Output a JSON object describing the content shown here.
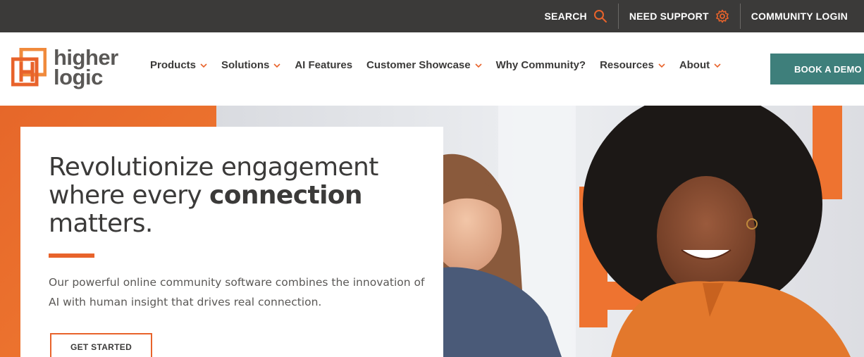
{
  "topbar": {
    "items": [
      {
        "label": "SEARCH",
        "icon": "search-icon"
      },
      {
        "label": "NEED SUPPORT",
        "icon": "gear-icon"
      },
      {
        "label": "COMMUNITY LOGIN"
      }
    ]
  },
  "logo": {
    "line1": "higher",
    "line2": "logic",
    "icon": "logo-h-icon"
  },
  "nav": {
    "items": [
      {
        "label": "Products",
        "has_dropdown": true
      },
      {
        "label": "Solutions",
        "has_dropdown": true
      },
      {
        "label": "AI Features",
        "has_dropdown": false
      },
      {
        "label": "Customer Showcase",
        "has_dropdown": true
      },
      {
        "label": "Why Community?",
        "has_dropdown": false
      },
      {
        "label": "Resources",
        "has_dropdown": true
      },
      {
        "label": "About",
        "has_dropdown": true
      }
    ],
    "cta": "BOOK A DEMO"
  },
  "hero": {
    "headline_1": "Revolutionize engagement",
    "headline_2a": "where every ",
    "headline_2b": "connection",
    "headline_3": "matters.",
    "subtext": "Our powerful online community software combines the innovation of AI with human insight that drives real connection.",
    "cta": "GET STARTED"
  },
  "colors": {
    "brand_orange": "#e8632b",
    "topbar_bg": "#3b3a39",
    "cta_teal": "#3e7f7b",
    "text_dark": "#3b3a39"
  }
}
